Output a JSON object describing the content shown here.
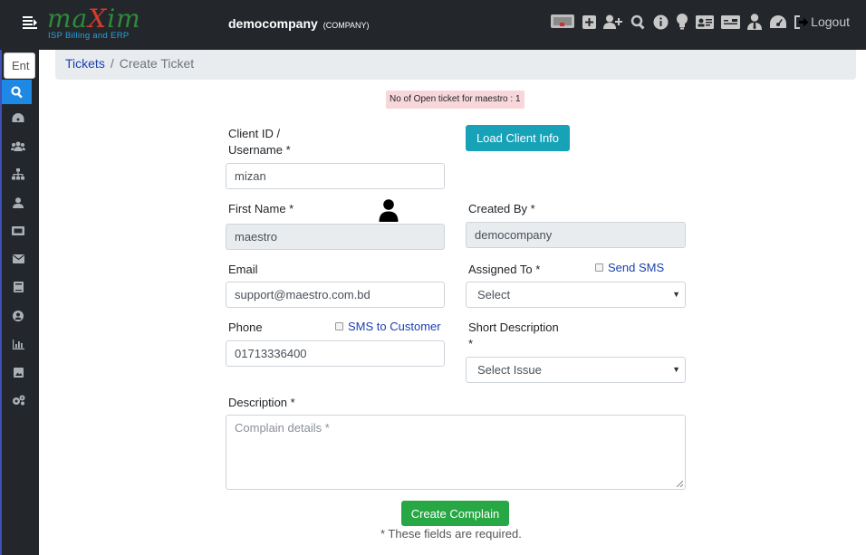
{
  "header": {
    "logo_text_left": "ma",
    "logo_text_x": "X",
    "logo_text_right": "im",
    "logo_subtitle": "ISP Billing and ERP",
    "company_name": "democompany",
    "company_tag": "(COMPANY)",
    "logout_label": "Logout"
  },
  "sidebar": {
    "search_placeholder": "Ent"
  },
  "breadcrumb": {
    "parent": "Tickets",
    "separator": "/",
    "current": "Create Ticket"
  },
  "open_ticket_notice": "No of Open ticket for maestro : 1",
  "form": {
    "client_id_label_line1": "Client ID /",
    "client_id_label_line2": "Username *",
    "client_id_value": "mizan",
    "load_button": "Load Client Info",
    "first_name_label": "First Name *",
    "first_name_value": "maestro",
    "created_by_label": "Created By *",
    "created_by_value": "democompany",
    "email_label": "Email",
    "email_value": "support@maestro.com.bd",
    "assigned_to_label": "Assigned To *",
    "send_sms_label": "Send SMS",
    "assigned_to_value": "Select",
    "phone_label": "Phone",
    "sms_to_customer_label": "SMS to Customer",
    "phone_value": "01713336400",
    "short_desc_label_line1": "Short Description",
    "short_desc_label_line2": "*",
    "short_desc_value": "Select Issue",
    "description_label": "Description *",
    "description_placeholder": "Complain details *",
    "submit_button": "Create Complain",
    "required_note": "* These fields are required."
  },
  "colors": {
    "topbar": "#23272b",
    "accent_blue": "#1e88e5",
    "info_button": "#17a2b8",
    "success_button": "#28a745",
    "notice_bg": "#f8d7da"
  }
}
